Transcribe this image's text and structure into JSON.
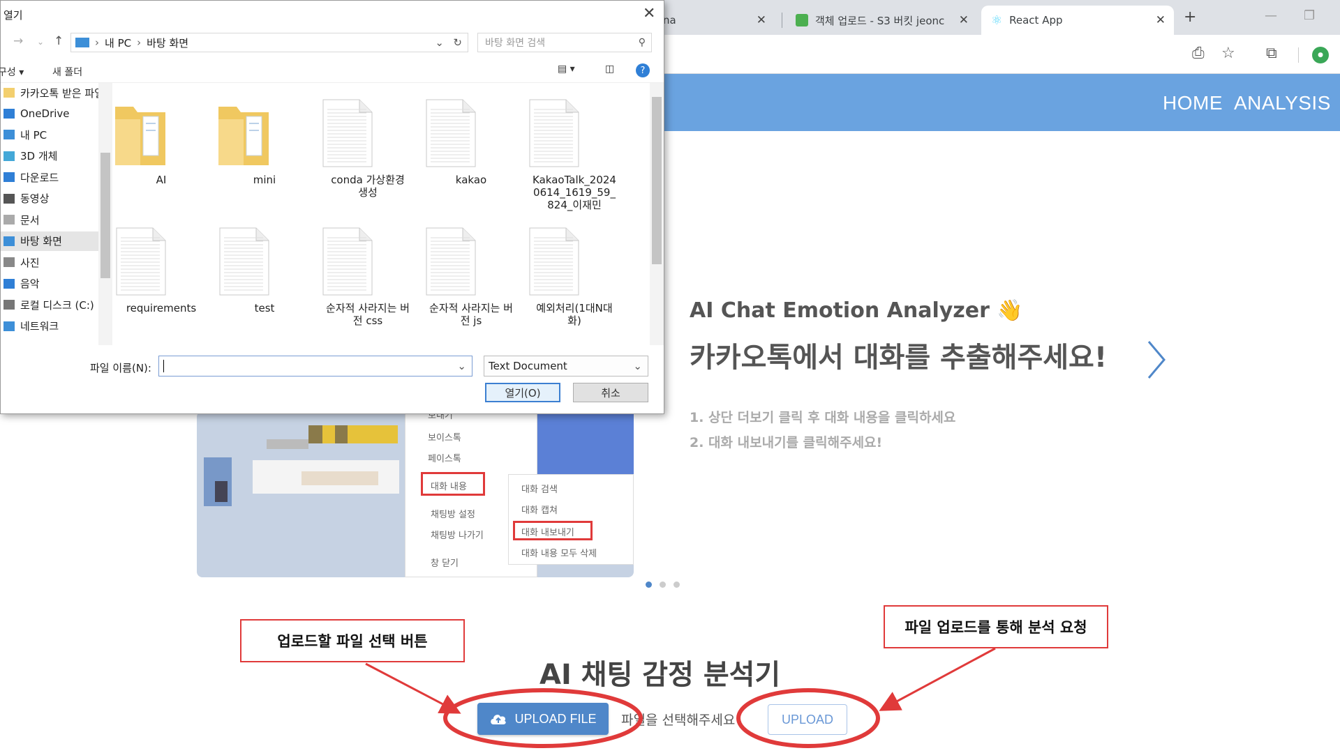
{
  "browser": {
    "tabs": [
      {
        "label": "na"
      },
      {
        "label": "객체 업로드 - S3 버킷 jeonc"
      },
      {
        "label": "React App"
      }
    ]
  },
  "app": {
    "nav": {
      "home": "HOME",
      "analysis": "ANALYSIS"
    },
    "carousel": {
      "menu_items": [
        "보내기",
        "보이스톡",
        "페이스톡",
        "대화 내용",
        "채팅방 설정",
        "채팅방 나가기",
        "창 닫기"
      ],
      "submenu_items": [
        "대화 검색",
        "대화 캡쳐",
        "대화 내보내기",
        "대화 내용 모두 삭제"
      ],
      "hero_title": "AI Chat Emotion Analyzer 👋",
      "hero_subtitle": "카카오톡에서 대화를 추출해주세요!",
      "steps": [
        "1. 상단 더보기 클릭 후 대화 내용을 클릭하세요",
        "2. 대화 내보내기를 클릭해주세요!"
      ]
    },
    "main_title": "AI 채팅 감정 분석기",
    "upload_file_label": "UPLOAD FILE",
    "file_status": "파일을 선택해주세요",
    "upload_label": "UPLOAD"
  },
  "annotations": {
    "left": "업로드할 파일 선택 버튼",
    "right": "파일 업로드를 통해 분석 요청"
  },
  "dialog": {
    "title": "열기",
    "breadcrumb": [
      "내 PC",
      "바탕 화면"
    ],
    "search_placeholder": "바탕 화면 검색",
    "toolbar": {
      "organize": "구성",
      "new_folder": "새 폴더"
    },
    "nav_items": [
      {
        "label": "카카오톡 받은 파일",
        "icon": "folder-icon"
      },
      {
        "label": "OneDrive",
        "icon": "cloud-icon"
      },
      {
        "label": "내 PC",
        "icon": "pc-icon"
      },
      {
        "label": "3D 개체",
        "icon": "cube-icon"
      },
      {
        "label": "다운로드",
        "icon": "download-icon"
      },
      {
        "label": "동영상",
        "icon": "video-icon"
      },
      {
        "label": "문서",
        "icon": "document-icon"
      },
      {
        "label": "바탕 화면",
        "icon": "desktop-icon"
      },
      {
        "label": "사진",
        "icon": "picture-icon"
      },
      {
        "label": "음악",
        "icon": "music-icon"
      },
      {
        "label": "로컬 디스크 (C:)",
        "icon": "disk-icon"
      },
      {
        "label": "네트워크",
        "icon": "network-icon"
      }
    ],
    "files": [
      {
        "name": "AI",
        "kind": "folder"
      },
      {
        "name": "mini",
        "kind": "folder"
      },
      {
        "name": "conda 가상환경 생성",
        "kind": "file"
      },
      {
        "name": "kakao",
        "kind": "file"
      },
      {
        "name": "KakaoTalk_20240614_1619_59_824_이재민",
        "kind": "file"
      },
      {
        "name": "requirements",
        "kind": "file"
      },
      {
        "name": "test",
        "kind": "file"
      },
      {
        "name": "순자적 사라지는 버전 css",
        "kind": "file"
      },
      {
        "name": "순자적 사라지는 버전 js",
        "kind": "file"
      },
      {
        "name": "예외처리(1대N대화)",
        "kind": "file"
      }
    ],
    "filename_label": "파일 이름(N):",
    "filename_value": "",
    "filetype": "Text Document",
    "open_label": "열기(O)",
    "cancel_label": "취소"
  },
  "colors": {
    "accent": "#6aa3e0",
    "button": "#4f87c9",
    "annotation": "#e03a3a"
  }
}
